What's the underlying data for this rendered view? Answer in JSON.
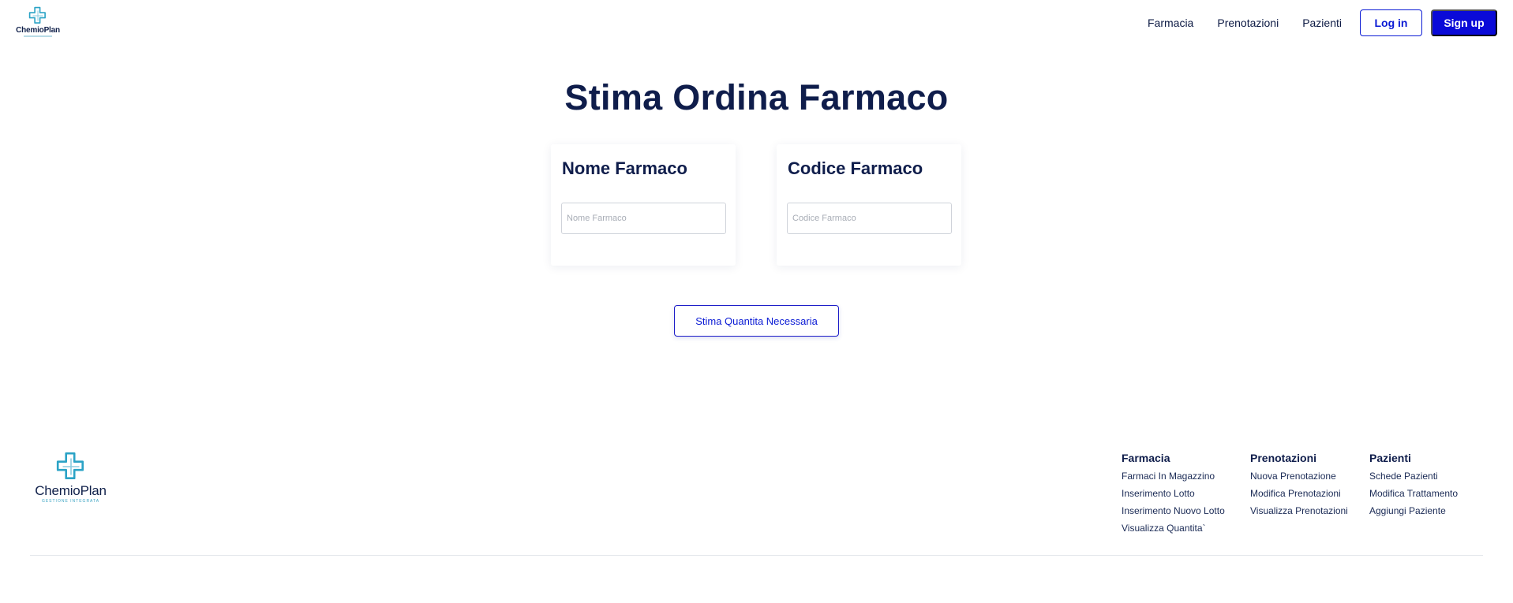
{
  "brand": {
    "name": "ChemioPlan",
    "tagline": "GESTIONE INTEGRATA",
    "accent_color": "#2ba3c6"
  },
  "nav": {
    "links": [
      "Farmacia",
      "Prenotazioni",
      "Pazienti"
    ],
    "login_label": "Log in",
    "signup_label": "Sign up"
  },
  "main": {
    "title": "Stima Ordina Farmaco",
    "cards": [
      {
        "title": "Nome Farmaco",
        "placeholder": "Nome Farmaco",
        "value": ""
      },
      {
        "title": "Codice Farmaco",
        "placeholder": "Codice Farmaco",
        "value": ""
      }
    ],
    "estimate_button_label": "Stima Quantita Necessaria"
  },
  "footer": {
    "columns": [
      {
        "heading": "Farmacia",
        "links": [
          "Farmaci In Magazzino",
          "Inserimento Lotto",
          "Inserimento Nuovo Lotto",
          "Visualizza Quantita`"
        ]
      },
      {
        "heading": "Prenotazioni",
        "links": [
          "Nuova Prenotazione",
          "Modifica Prenotazioni",
          "Visualizza Prenotazioni"
        ]
      },
      {
        "heading": "Pazienti",
        "links": [
          "Schede Pazienti",
          "Modifica Trattamento",
          "Aggiungi Paziente"
        ]
      }
    ]
  },
  "colors": {
    "primary": "#0a0ad8",
    "heading": "#0f1d4b"
  }
}
